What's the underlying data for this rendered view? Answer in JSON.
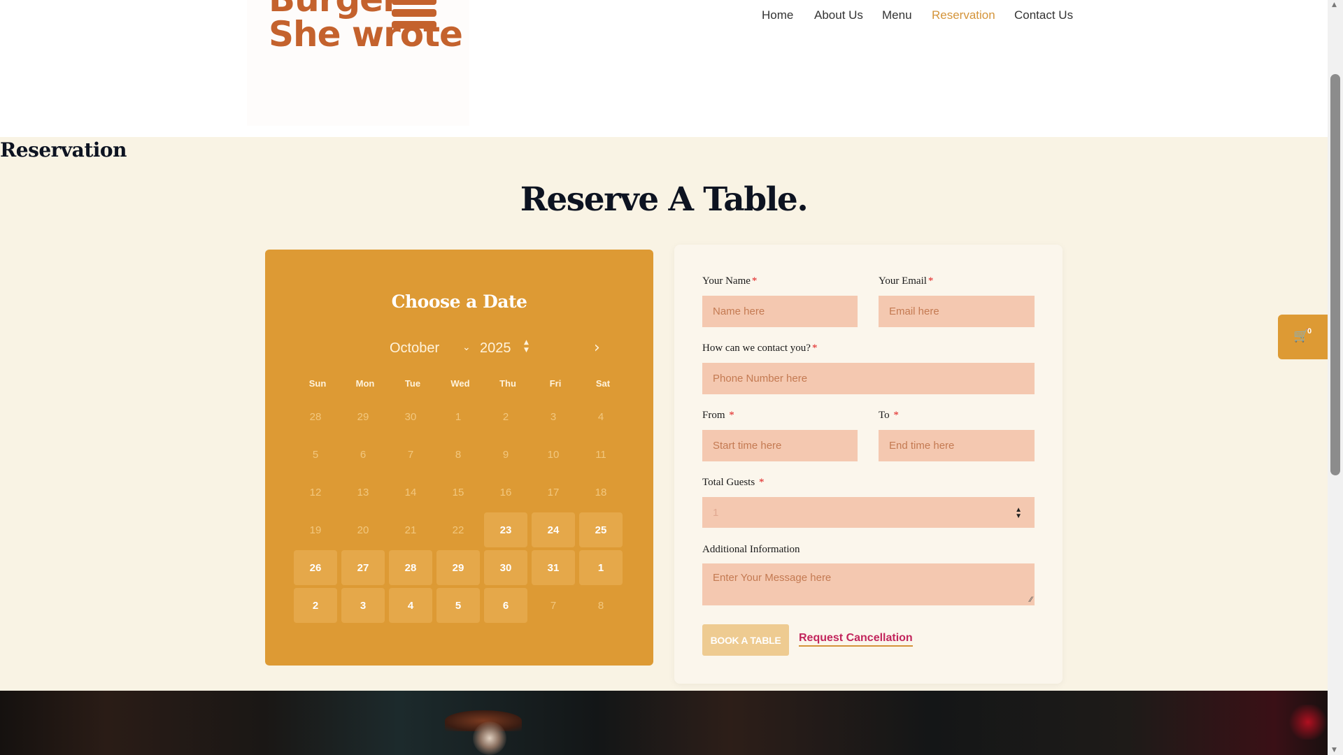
{
  "brand": {
    "line1": "Burger",
    "line2": "She wrote",
    "color": "#c4622d"
  },
  "nav": {
    "items": [
      {
        "label": "Home"
      },
      {
        "label": "About Us"
      },
      {
        "label": "Menu"
      },
      {
        "label": "Reservation",
        "active": true
      },
      {
        "label": "Contact Us"
      }
    ]
  },
  "page": {
    "title": "Reservation",
    "heading": "Reserve A Table."
  },
  "calendar": {
    "title": "Choose a Date",
    "month": "October",
    "year": "2025",
    "weekdays": [
      "Sun",
      "Mon",
      "Tue",
      "Wed",
      "Thu",
      "Fri",
      "Sat"
    ],
    "days": [
      [
        "28",
        false
      ],
      [
        "29",
        false
      ],
      [
        "30",
        false
      ],
      [
        "1",
        false
      ],
      [
        "2",
        false
      ],
      [
        "3",
        false
      ],
      [
        "4",
        false
      ],
      [
        "5",
        false
      ],
      [
        "6",
        false
      ],
      [
        "7",
        false
      ],
      [
        "8",
        false
      ],
      [
        "9",
        false
      ],
      [
        "10",
        false
      ],
      [
        "11",
        false
      ],
      [
        "12",
        false
      ],
      [
        "13",
        false
      ],
      [
        "14",
        false
      ],
      [
        "15",
        false
      ],
      [
        "16",
        false
      ],
      [
        "17",
        false
      ],
      [
        "18",
        false
      ],
      [
        "19",
        false
      ],
      [
        "20",
        false
      ],
      [
        "21",
        false
      ],
      [
        "22",
        false
      ],
      [
        "23",
        true
      ],
      [
        "24",
        true
      ],
      [
        "25",
        true
      ],
      [
        "26",
        true
      ],
      [
        "27",
        true
      ],
      [
        "28",
        true
      ],
      [
        "29",
        true
      ],
      [
        "30",
        true
      ],
      [
        "31",
        true
      ],
      [
        "1",
        true
      ],
      [
        "2",
        true
      ],
      [
        "3",
        true
      ],
      [
        "4",
        true
      ],
      [
        "5",
        true
      ],
      [
        "6",
        true
      ],
      [
        "7",
        false
      ],
      [
        "8",
        false
      ]
    ],
    "accent": "#dd9a34"
  },
  "form": {
    "name_label": "Your Name",
    "name_placeholder": "Name here",
    "email_label": "Your Email",
    "email_placeholder": "Email here",
    "contact_label": "How can we contact you?",
    "phone_placeholder": "Phone Number here",
    "from_label": "From",
    "from_placeholder": "Start time here",
    "to_label": "To",
    "to_placeholder": "End time here",
    "guests_label": "Total Guests",
    "guests_value": "1",
    "info_label": "Additional Information",
    "info_placeholder": "Enter Your Message here",
    "required_mark": "*",
    "book_button": "BOOK A TABLE",
    "cancel_link": "Request Cancellation"
  },
  "cart": {
    "count": "0",
    "icon": "cart-icon"
  }
}
